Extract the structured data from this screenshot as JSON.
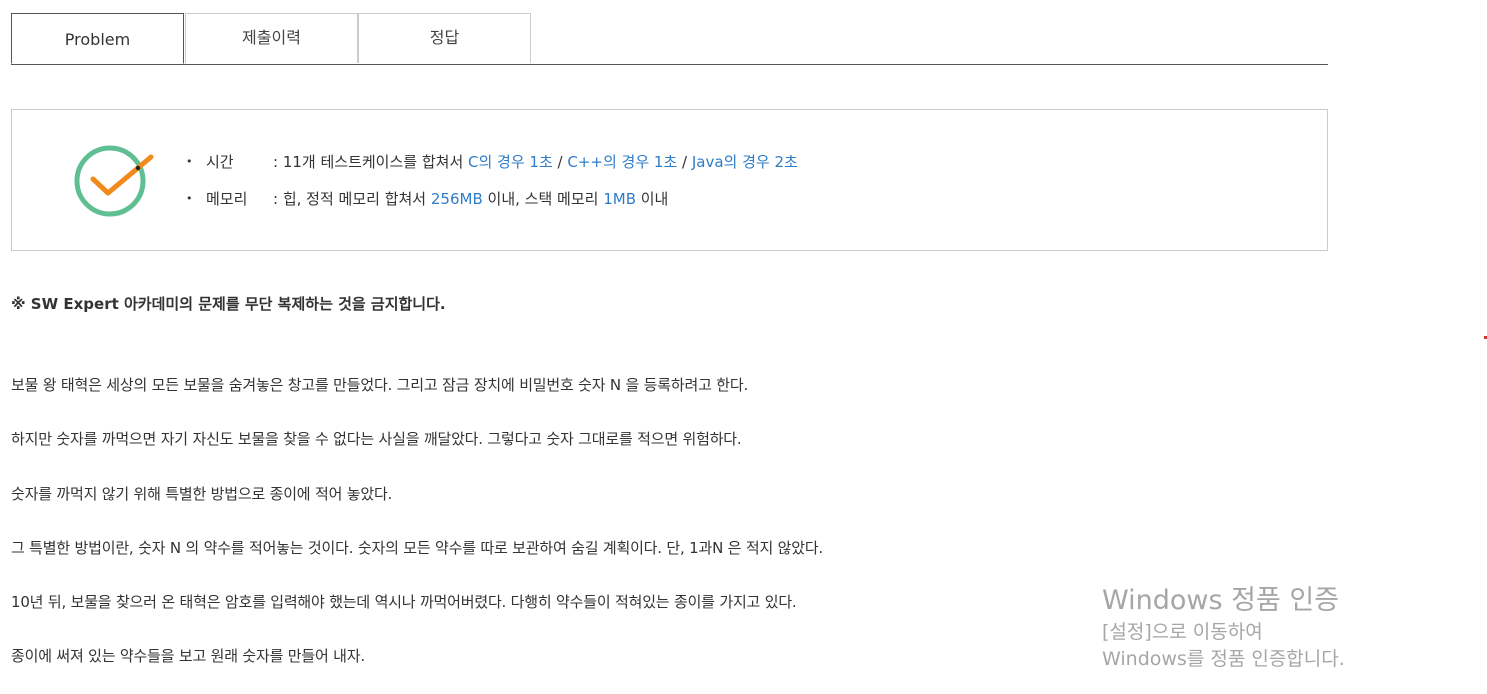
{
  "tabs": [
    {
      "label": "Problem",
      "active": true
    },
    {
      "label": "제출이력",
      "active": false
    },
    {
      "label": "정답",
      "active": false
    }
  ],
  "limits": {
    "icon": "check-icon",
    "time": {
      "label": "시간",
      "prefix": ": 11개 테스트케이스를 합쳐서 ",
      "c": "C의 경우 1초",
      "sep1": " / ",
      "cpp": "C++의 경우 1초",
      "sep2": " / ",
      "java": "Java의 경우 2초"
    },
    "memory": {
      "label": "메모리",
      "prefix": ": 힙, 정적 메모리 합쳐서 ",
      "heap": "256MB",
      "mid": " 이내, 스택 메모리 ",
      "stack": "1MB",
      "suffix": " 이내"
    }
  },
  "notice": "※ SW Expert 아카데미의 문제를 무단 복제하는 것을 금지합니다.",
  "paragraphs": [
    "보물 왕 태혁은 세상의 모든 보물을 숨겨놓은 창고를 만들었다. 그리고 잠금 장치에 비밀번호 숫자 N 을 등록하려고 한다.",
    "하지만 숫자를 까먹으면 자기 자신도 보물을 찾을 수 없다는 사실을 깨달았다. 그렇다고 숫자 그대로를 적으면 위험하다.",
    "숫자를 까먹지 않기 위해 특별한 방법으로 종이에 적어 놓았다.",
    "그 특별한 방법이란, 숫자 N 의 약수를 적어놓는 것이다. 숫자의 모든 약수를 따로 보관하여 숨길 계획이다. 단, 1과N 은 적지 않았다.",
    "10년 뒤, 보물을 찾으러 온 태혁은 암호를 입력해야 했는데 역시나 까먹어버렸다. 다행히 약수들이 적혀있는 종이를 가지고 있다.",
    "종이에 써져 있는 약수들을 보고 원래 숫자를 만들어 내자."
  ],
  "watermark": {
    "title": "Windows 정품 인증",
    "subtitle": "[설정]으로 이동하여 Windows를 정품 인증합니다."
  },
  "colors": {
    "link": "#2f7cc8",
    "check_circle": "#5fbf93",
    "check_mark": "#f18a1a"
  }
}
